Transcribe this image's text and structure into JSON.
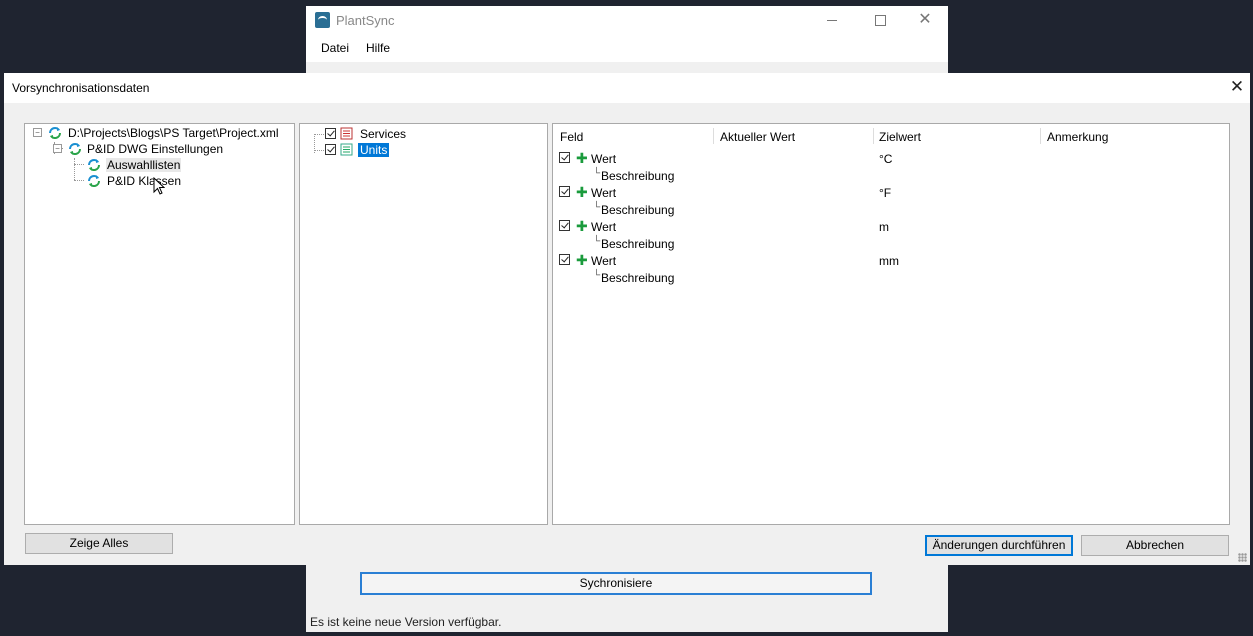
{
  "background_window": {
    "title": "PlantSync",
    "menu": [
      "Datei",
      "Hilfe"
    ],
    "sync_button_label": "Sychronisiere",
    "status_text": "Es ist keine neue Version verfügbar.",
    "controls": {
      "minimize_icon": "minimize-icon",
      "maximize_icon": "maximize-icon",
      "close_icon": "close-icon",
      "close_glyph": "✕"
    }
  },
  "dialog": {
    "title": "Vorsynchronisationsdaten",
    "close_glyph": "✕",
    "left_tree": {
      "root": {
        "label": "D:\\Projects\\Blogs\\PS Target\\Project.xml",
        "expander": "−"
      },
      "child": {
        "label": "P&ID DWG Einstellungen",
        "expander": "−"
      },
      "items": [
        {
          "label": "Auswahllisten"
        },
        {
          "label": "P&ID Klassen"
        }
      ]
    },
    "middle_tree": {
      "items": [
        {
          "label": "Services",
          "checked": true,
          "selected": false
        },
        {
          "label": "Units",
          "checked": true,
          "selected": true
        }
      ]
    },
    "grid": {
      "columns": [
        "Feld",
        "Aktueller Wert",
        "Zielwert",
        "Anmerkung"
      ],
      "rows": [
        {
          "field": "Wert",
          "sub": "Beschreibung",
          "target": "°C",
          "checked": true
        },
        {
          "field": "Wert",
          "sub": "Beschreibung",
          "target": "°F",
          "checked": true
        },
        {
          "field": "Wert",
          "sub": "Beschreibung",
          "target": "m",
          "checked": true
        },
        {
          "field": "Wert",
          "sub": "Beschreibung",
          "target": "mm",
          "checked": true
        }
      ],
      "sub_prefix": "└",
      "plus_glyph": "✚"
    },
    "buttons": {
      "show_all": "Zeige Alles",
      "apply": "Änderungen durchführen",
      "cancel": "Abbrechen"
    }
  },
  "colors": {
    "selection": "#0078d7",
    "add_icon": "#1a9b3c",
    "accent_border": "#2a7fd4"
  }
}
